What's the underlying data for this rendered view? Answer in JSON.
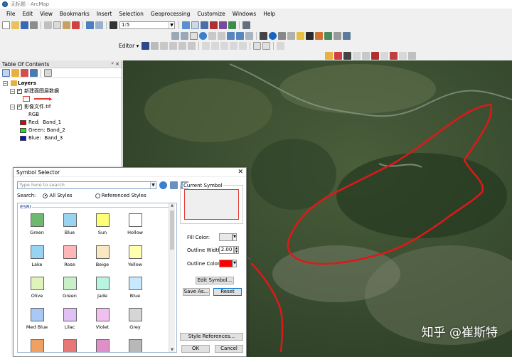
{
  "window": {
    "title": "无标题 - ArcMap"
  },
  "menu": [
    "File",
    "Edit",
    "View",
    "Bookmarks",
    "Insert",
    "Selection",
    "Geoprocessing",
    "Customize",
    "Windows",
    "Help"
  ],
  "toolbar": {
    "scale_value": "1:5",
    "editor_label": "Editor ▾"
  },
  "toc": {
    "title": "Table Of Contents",
    "pin_glyphs": "ᵖ ×",
    "root": "Layers",
    "layers": [
      {
        "name": "新建面图层数据",
        "checked": true
      },
      {
        "name": "影像文件.tif",
        "checked": true
      }
    ],
    "rgb_label": "RGB",
    "bands": [
      {
        "channel": "Red:",
        "band": "Band_1",
        "color": "#e00000"
      },
      {
        "channel": "Green:",
        "band": "Band_2",
        "color": "#22dd22"
      },
      {
        "channel": "Blue:",
        "band": "Band_3",
        "color": "#1010c8"
      }
    ]
  },
  "map": {
    "watermark": "知乎 @崔斯特",
    "polygon_color": "#e01818"
  },
  "dialog": {
    "title": "Symbol Selector",
    "close_glyph": "✕",
    "search_placeholder": "Type here to search",
    "search_label": "Search:",
    "radio_all": "All Styles",
    "radio_referenced": "Referenced Styles",
    "group_name": "ESRI",
    "symbols": [
      {
        "label": "Green",
        "color": "#6db96d"
      },
      {
        "label": "Blue",
        "color": "#9ad3f0"
      },
      {
        "label": "Sun",
        "color": "#ffff73"
      },
      {
        "label": "Hollow",
        "color": "#ffffff"
      },
      {
        "label": "Lake",
        "color": "#97d3f5"
      },
      {
        "label": "Rose",
        "color": "#ffb6b6"
      },
      {
        "label": "Beige",
        "color": "#fbe7c0"
      },
      {
        "label": "Yellow",
        "color": "#ffffb0"
      },
      {
        "label": "Olive",
        "color": "#e0f3b8"
      },
      {
        "label": "Green",
        "color": "#c8f0c8"
      },
      {
        "label": "Jade",
        "color": "#b8f5e0"
      },
      {
        "label": "Blue",
        "color": "#c8e8ff"
      },
      {
        "label": "Med Blue",
        "color": "#a8c8f5"
      },
      {
        "label": "Lilac",
        "color": "#e0c0f5"
      },
      {
        "label": "Violet",
        "color": "#f0c0f0"
      },
      {
        "label": "Grey",
        "color": "#d6d6d6"
      },
      {
        "label": "",
        "color": "#f0a060"
      },
      {
        "label": "",
        "color": "#e87878"
      },
      {
        "label": "",
        "color": "#e090c8"
      },
      {
        "label": "",
        "color": "#b8b8b8"
      }
    ],
    "current_symbol_label": "Current Symbol",
    "fill_color_label": "Fill Color:",
    "outline_width_label": "Outline Width:",
    "outline_width_value": "2.00",
    "outline_color_label": "Outline Color:",
    "outline_color": "#ff0000",
    "edit_symbol_button": "Edit Symbol...",
    "save_as_button": "Save As...",
    "reset_button": "Reset",
    "style_references_button": "Style References...",
    "ok_button": "OK",
    "cancel_button": "Cancel"
  }
}
